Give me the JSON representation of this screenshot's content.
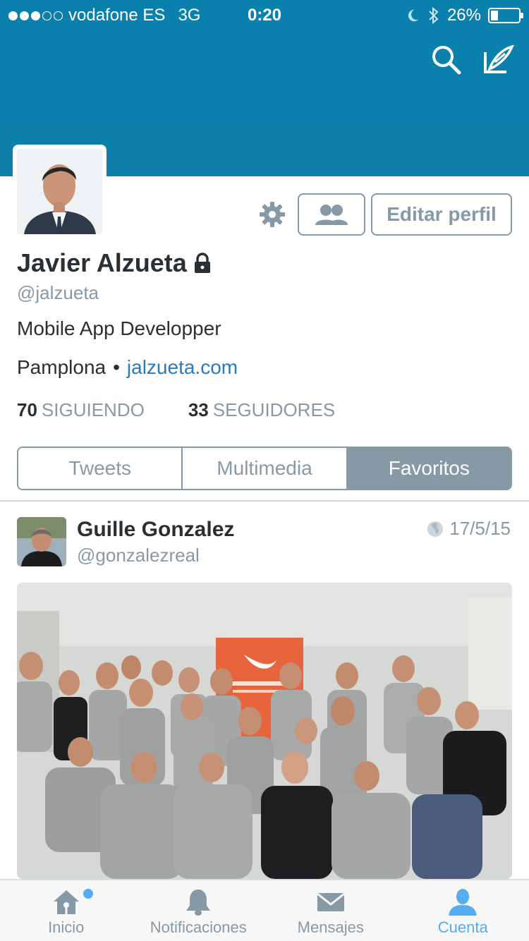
{
  "status_bar": {
    "carrier": "vodafone ES",
    "network": "3G",
    "time": "0:20",
    "battery": "26%",
    "signal_filled": 3,
    "signal_total": 5
  },
  "header": {
    "icons": [
      "search-icon",
      "compose-icon"
    ]
  },
  "profile": {
    "name": "Javier Alzueta",
    "handle": "@jalzueta",
    "bio": "Mobile App Developper",
    "location": "Pamplona",
    "separator": "•",
    "website": "jalzueta.com",
    "following_count": "70",
    "following_label": "SIGUIENDO",
    "followers_count": "33",
    "followers_label": "SEGUIDORES",
    "edit_button": "Editar perfil",
    "protected": true
  },
  "tabs_segment": {
    "items": [
      "Tweets",
      "Multimedia",
      "Favoritos"
    ],
    "selected": "Favoritos"
  },
  "tweet": {
    "author": "Guille Gonzalez",
    "handle": "@gonzalezreal",
    "date": "17/5/15"
  },
  "tabbar": {
    "items": [
      {
        "label": "Inicio",
        "icon": "home-icon"
      },
      {
        "label": "Notificaciones",
        "icon": "bell-icon"
      },
      {
        "label": "Mensajes",
        "icon": "envelope-icon"
      },
      {
        "label": "Cuenta",
        "icon": "person-icon"
      }
    ],
    "active": "Cuenta"
  },
  "colors": {
    "banner": "#0a80ac",
    "gray": "#8899a6",
    "link": "#2b7bb9",
    "active_tab": "#55acee"
  }
}
